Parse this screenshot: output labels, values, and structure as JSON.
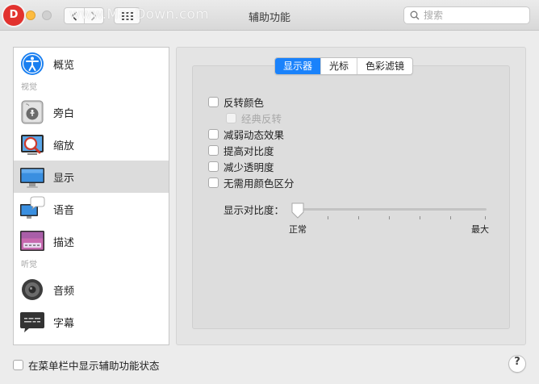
{
  "window": {
    "title": "辅助功能",
    "watermark": "www.MacDown.com",
    "logo_letter": "D"
  },
  "search": {
    "placeholder": "搜索",
    "value": ""
  },
  "sidebar": {
    "items": [
      {
        "label": "概览",
        "icon": "accessibility-icon"
      },
      {
        "section": "视觉"
      },
      {
        "label": "旁白",
        "icon": "voiceover-icon"
      },
      {
        "label": "缩放",
        "icon": "zoom-icon"
      },
      {
        "label": "显示",
        "icon": "display-icon",
        "selected": true
      },
      {
        "label": "语音",
        "icon": "speech-icon"
      },
      {
        "label": "描述",
        "icon": "descriptions-icon"
      },
      {
        "section": "听觉"
      },
      {
        "label": "音频",
        "icon": "audio-icon"
      },
      {
        "label": "字幕",
        "icon": "captions-icon"
      }
    ]
  },
  "tabs": [
    {
      "label": "显示器",
      "active": true
    },
    {
      "label": "光标",
      "active": false
    },
    {
      "label": "色彩滤镜",
      "active": false
    }
  ],
  "options": [
    {
      "label": "反转颜色",
      "checked": false,
      "disabled": false
    },
    {
      "label": "经典反转",
      "checked": false,
      "disabled": true
    },
    {
      "label": "减弱动态效果",
      "checked": false,
      "disabled": false
    },
    {
      "label": "提高对比度",
      "checked": false,
      "disabled": false
    },
    {
      "label": "减少透明度",
      "checked": false,
      "disabled": false
    },
    {
      "label": "无需用颜色区分",
      "checked": false,
      "disabled": false
    }
  ],
  "contrast": {
    "label": "显示对比度：",
    "min_label": "正常",
    "max_label": "最大",
    "value": 0
  },
  "footer": {
    "status_label": "在菜单栏中显示辅助功能状态",
    "status_checked": false,
    "help_label": "?"
  },
  "colors": {
    "accent": "#1a82fb",
    "close": "#fc605c",
    "minimize": "#fdbc40"
  }
}
